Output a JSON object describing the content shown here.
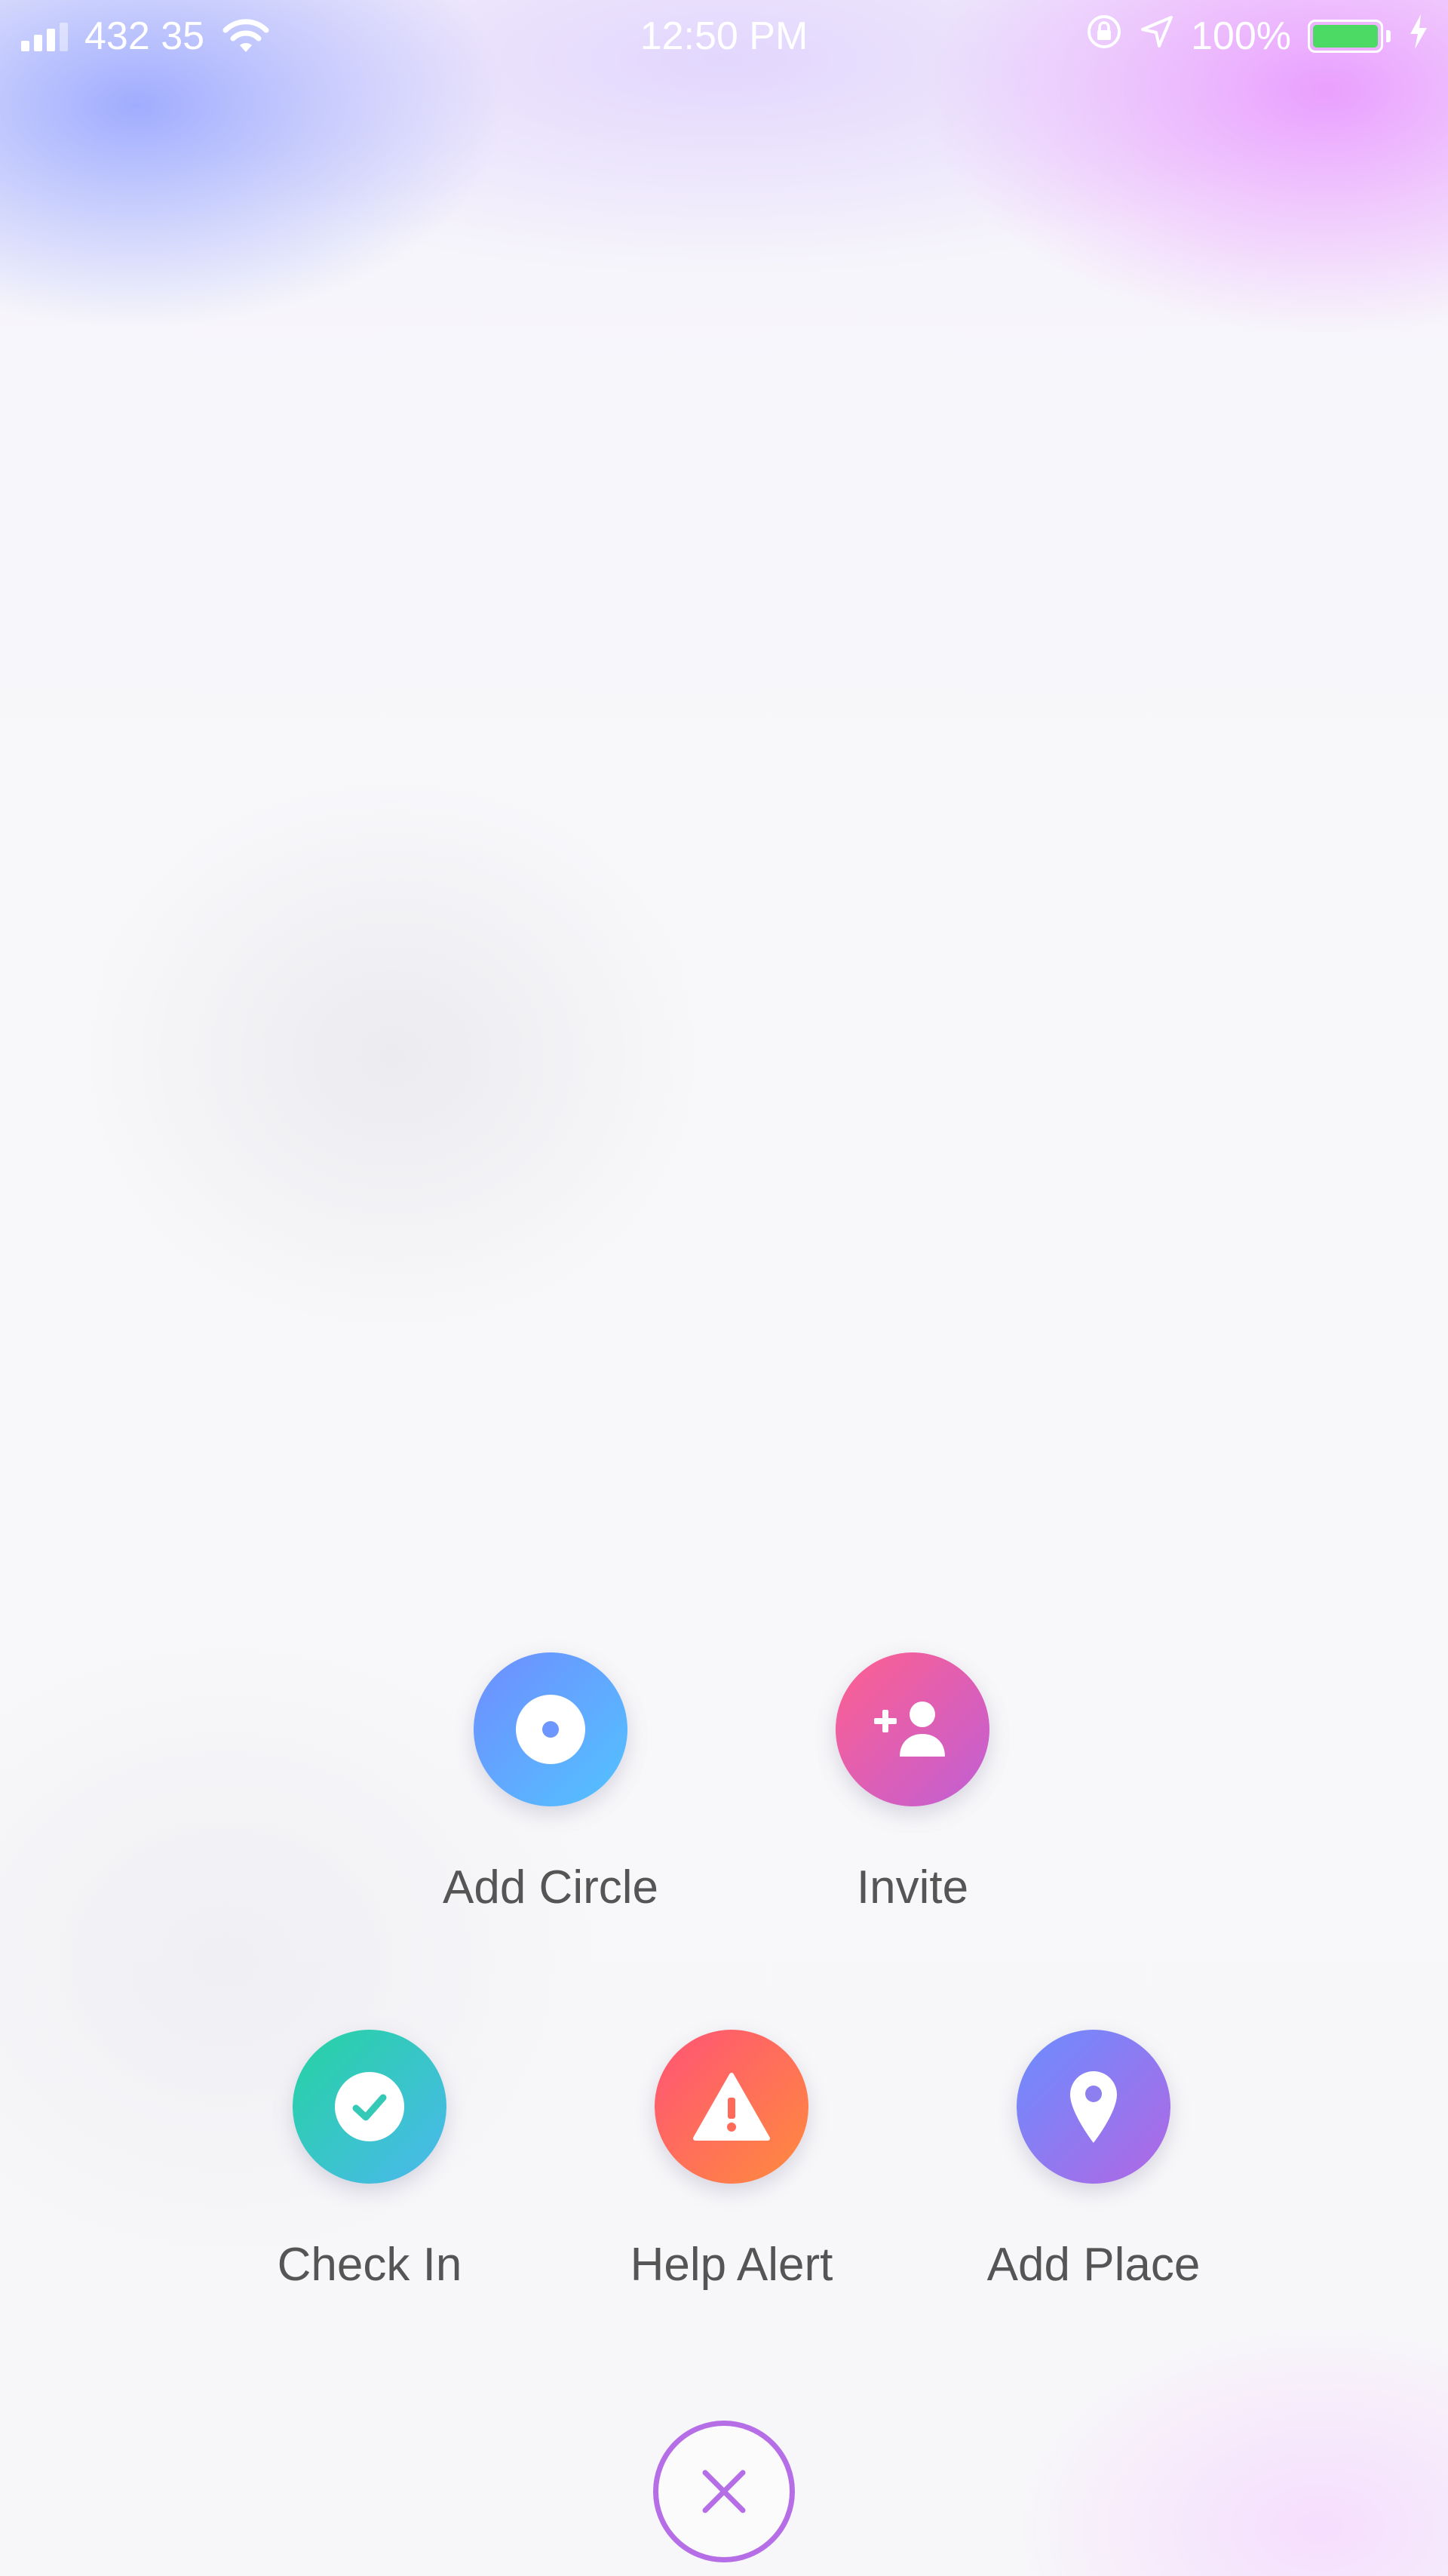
{
  "status_bar": {
    "carrier": "432 35",
    "time": "12:50 PM",
    "battery_percent": "100%",
    "battery_level": 1.0,
    "battery_color": "#4cd964",
    "icons": [
      "signal-icon",
      "wifi-icon",
      "orientation-lock-icon",
      "location-arrow-icon",
      "battery-icon",
      "charging-bolt-icon"
    ]
  },
  "actions": {
    "add_circle": {
      "label": "Add Circle",
      "icon": "circle-dot-icon"
    },
    "invite": {
      "label": "Invite",
      "icon": "add-person-icon"
    },
    "check_in": {
      "label": "Check In",
      "icon": "check-icon"
    },
    "help_alert": {
      "label": "Help Alert",
      "icon": "warning-icon"
    },
    "add_place": {
      "label": "Add Place",
      "icon": "map-pin-icon"
    }
  },
  "close": {
    "icon": "close-icon",
    "color": "#b56ee6"
  },
  "colors": {
    "add_circle": [
      "#6f8dff",
      "#52c3ff"
    ],
    "invite": [
      "#ff5f8f",
      "#c05fd6"
    ],
    "check_in": [
      "#25d3a1",
      "#4bb8ee"
    ],
    "help_alert": [
      "#ff5376",
      "#ff8b3d"
    ],
    "add_place": [
      "#6b8dff",
      "#b167e3"
    ]
  }
}
